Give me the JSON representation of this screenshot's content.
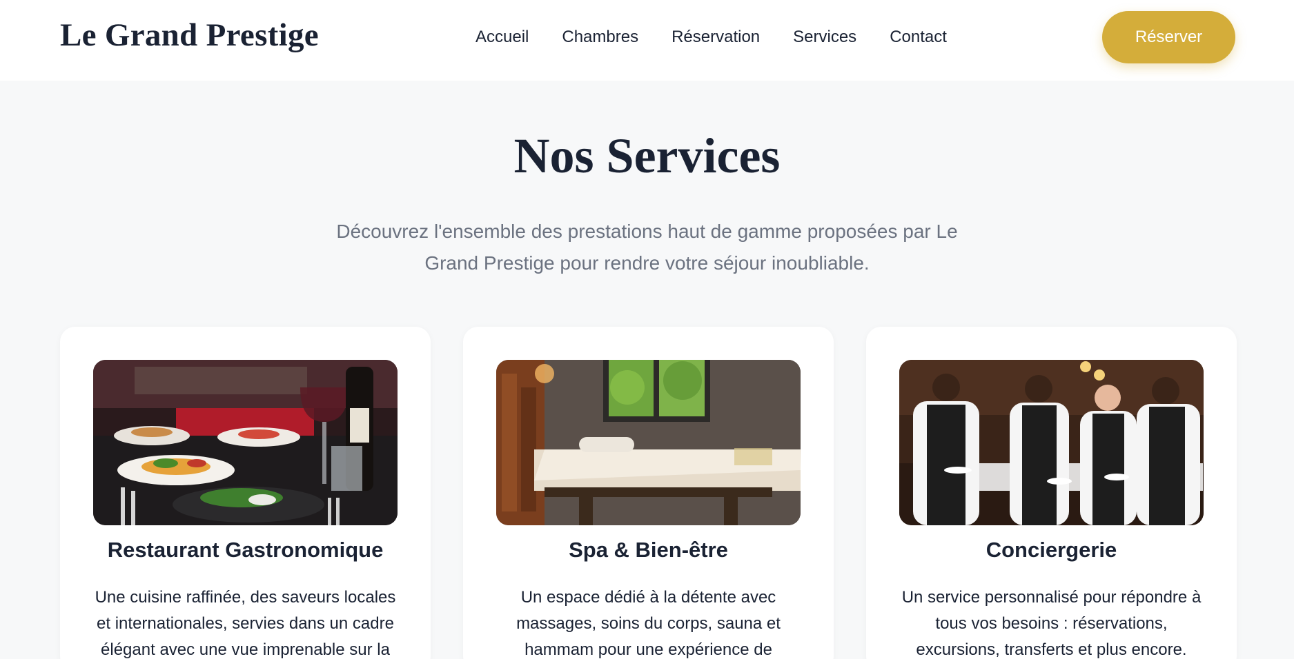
{
  "header": {
    "logo": "Le Grand Prestige",
    "nav": [
      "Accueil",
      "Chambres",
      "Réservation",
      "Services",
      "Contact"
    ],
    "cta": "Réserver"
  },
  "services": {
    "title": "Nos Services",
    "subtitle": "Découvrez l'ensemble des prestations haut de gamme proposées par Le Grand Prestige pour rendre votre séjour inoubliable.",
    "cards": [
      {
        "title": "Restaurant Gastronomique",
        "text": "Une cuisine raffinée, des saveurs locales et internationales, servies dans un cadre élégant avec une vue imprenable sur la",
        "image": "restaurant-table-photo"
      },
      {
        "title": "Spa & Bien-être",
        "text": "Un espace dédié à la détente avec massages, soins du corps, sauna et hammam pour une expérience de",
        "image": "spa-massage-room-photo"
      },
      {
        "title": "Conciergerie",
        "text": "Un service personnalisé pour répondre à tous vos besoins : réservations, excursions, transferts et plus encore.",
        "image": "concierge-staff-photo"
      }
    ]
  },
  "colors": {
    "accent": "#d4ad3a",
    "text": "#1a2233",
    "muted": "#6b7280",
    "background": "#f7f8f9"
  }
}
